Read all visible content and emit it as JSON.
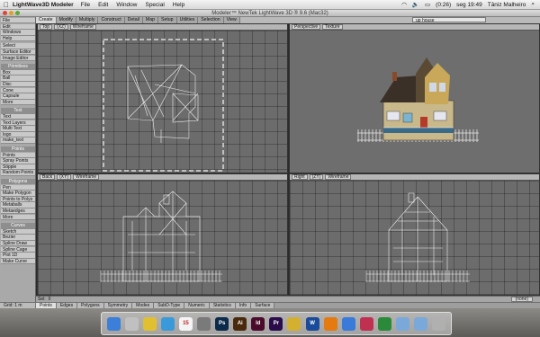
{
  "menubar": {
    "app_name": "LightWave3D Modeler",
    "items": [
      "File",
      "Edit",
      "Window",
      "Special",
      "Help"
    ],
    "battery": "(0:26)",
    "clock": "seg 19:49",
    "user": "Tâniz Malheiro"
  },
  "window": {
    "title": "Modeler™ NewTek LightWave 3D ® 9.6  (Mac32)"
  },
  "toolbar": {
    "tabs": [
      "Create",
      "Modify",
      "Multiply",
      "Construct",
      "Detail",
      "Map",
      "Setup",
      "Utilities",
      "Selection",
      "View"
    ],
    "active_tab": "Create",
    "layer_select": "up house"
  },
  "sidebar": {
    "top_buttons": [
      "File",
      "Edit",
      "Windows",
      "Help",
      "Select",
      "Surface Editor",
      "Image Editor"
    ],
    "sections": [
      {
        "title": "Primitives",
        "items": [
          "Box",
          "Ball",
          "Disc",
          "Cone",
          "Capsule",
          "More"
        ]
      },
      {
        "title": "Text",
        "items": [
          "Text",
          "Text Layers",
          "Multi Text",
          "logo",
          "make_text"
        ]
      },
      {
        "title": "Points",
        "items": [
          "Points",
          "Spray Points",
          "Stipple",
          "Random Points"
        ]
      },
      {
        "title": "Polygons",
        "items": [
          "Pen",
          "Make Polygon",
          "Points to Polys",
          "Metaballs",
          "Metaedges",
          "More"
        ]
      },
      {
        "title": "Curves",
        "items": [
          "Sketch",
          "Bezier",
          "Spline Draw",
          "Spline Cage",
          "Plot 1D",
          "Make Curve"
        ]
      }
    ]
  },
  "viewports": [
    {
      "name": "Top",
      "axis": "(XZ)",
      "mode": "Wireframe"
    },
    {
      "name": "Perspective",
      "axis": "",
      "mode": "Texture"
    },
    {
      "name": "Back",
      "axis": "(XY)",
      "mode": "Wireframe"
    },
    {
      "name": "Right",
      "axis": "(ZY)",
      "mode": "Wireframe"
    }
  ],
  "statusbar": {
    "label": "Sel:",
    "value": "0",
    "grid_label": "Grid:",
    "grid_value": "1 m",
    "vmap": "(none)"
  },
  "modebar": {
    "buttons": [
      "Points",
      "Edges",
      "Polygons",
      "Symmetry",
      "Modes",
      "SubD-Type",
      "Numeric",
      "Statistics",
      "Info",
      "Surface"
    ],
    "active": "Points"
  },
  "dock": {
    "apps": [
      {
        "name": "finder-icon",
        "label": "",
        "color": "#3b7fd8"
      },
      {
        "name": "preview-icon",
        "label": "",
        "color": "#c0c0c0"
      },
      {
        "name": "chrome-icon",
        "label": "",
        "color": "#e0c030"
      },
      {
        "name": "safari-icon",
        "label": "",
        "color": "#3a9ad9"
      },
      {
        "name": "calendar-icon",
        "label": "15",
        "color": "#f4f4f4"
      },
      {
        "name": "itunes-icon",
        "label": "",
        "color": "#7a7a7a"
      },
      {
        "name": "photoshop-icon",
        "label": "Ps",
        "color": "#0c2a4a"
      },
      {
        "name": "illustrator-icon",
        "label": "Ai",
        "color": "#4a2a0c"
      },
      {
        "name": "indesign-icon",
        "label": "Id",
        "color": "#4a0c2a"
      },
      {
        "name": "premiere-icon",
        "label": "Pr",
        "color": "#2a0c4a"
      },
      {
        "name": "lightwave-icon",
        "label": "",
        "color": "#d4b030"
      },
      {
        "name": "word-icon",
        "label": "W",
        "color": "#1a4a9a"
      },
      {
        "name": "vlc-icon",
        "label": "",
        "color": "#e47a10"
      },
      {
        "name": "app-store-icon",
        "label": "",
        "color": "#3a7ad9"
      },
      {
        "name": "pinwheel-icon",
        "label": "",
        "color": "#c03050"
      },
      {
        "name": "lightwave-layout-icon",
        "label": "",
        "color": "#2a8a3a"
      },
      {
        "name": "folder-icon",
        "label": "",
        "color": "#7aa9d9"
      },
      {
        "name": "downloads-icon",
        "label": "",
        "color": "#7aa9d9"
      },
      {
        "name": "trash-icon",
        "label": "",
        "color": "#b0b0b0"
      }
    ]
  }
}
